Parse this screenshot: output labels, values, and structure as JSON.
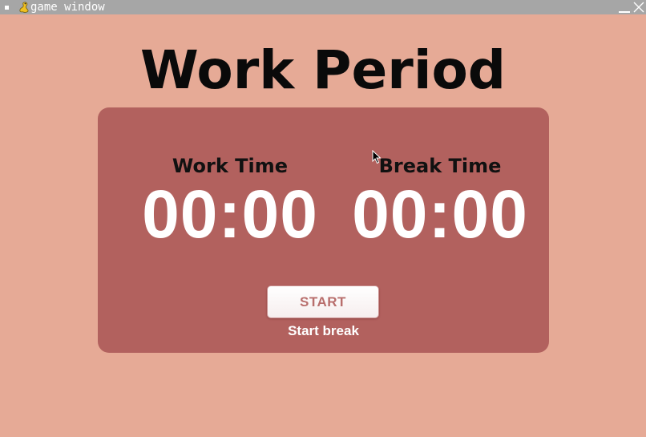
{
  "window": {
    "title": "game window"
  },
  "page": {
    "title": "Work Period"
  },
  "timers": {
    "work": {
      "label": "Work Time",
      "value": "00:00"
    },
    "break": {
      "label": "Break Time",
      "value": "00:00"
    }
  },
  "controls": {
    "start_label": "START",
    "mode_link_label": "Start break"
  },
  "icons": {
    "app": "pygame-snake-icon",
    "minimize": "minimize-icon",
    "close": "close-icon",
    "cursor": "mouse-pointer-icon"
  },
  "colors": {
    "background": "#e6aa96",
    "card": "#b2615e",
    "titlebar": "#a6a6a6",
    "button_text": "#b86e6c"
  }
}
